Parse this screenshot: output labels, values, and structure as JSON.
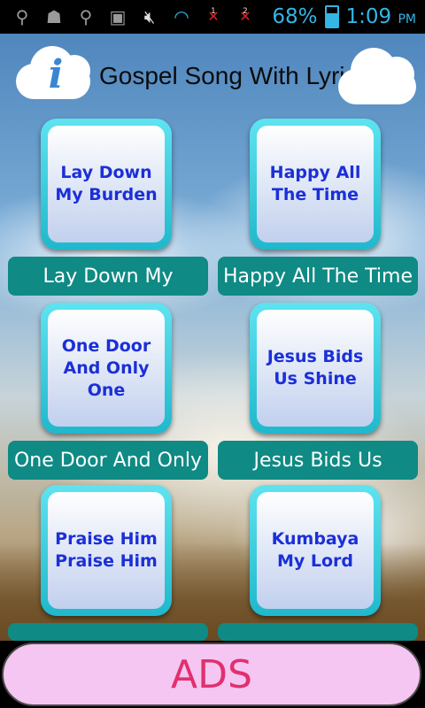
{
  "status_bar": {
    "icons": [
      "usb-icon",
      "android-debug-icon",
      "usb-icon",
      "image-icon",
      "mute-icon",
      "wifi-icon",
      "sim1-no-signal-icon",
      "sim2-no-signal-icon"
    ],
    "sim1_label": "1",
    "sim2_label": "2",
    "battery": "68%",
    "time": "1:09",
    "ampm": "PM"
  },
  "header": {
    "title": "Gospel Song With Lyrics",
    "info_glyph": "i"
  },
  "songs": [
    {
      "tile": "Lay Down My Burden",
      "label": "Lay Down My"
    },
    {
      "tile": "Happy All The Time",
      "label": "Happy All The Time"
    },
    {
      "tile": "One Door And Only One",
      "label": "One Door And Only"
    },
    {
      "tile": "Jesus Bids Us Shine",
      "label": "Jesus Bids Us"
    },
    {
      "tile": "Praise Him Praise Him",
      "label": ""
    },
    {
      "tile": "Kumbaya My Lord",
      "label": ""
    }
  ],
  "ads": {
    "label": "ADS"
  },
  "colors": {
    "tile_text": "#1b2fd8",
    "label_bg": "#0f8a84",
    "ads_bg": "#f6c6f2",
    "ads_text": "#e0306f",
    "status_accent": "#33b5e5"
  }
}
